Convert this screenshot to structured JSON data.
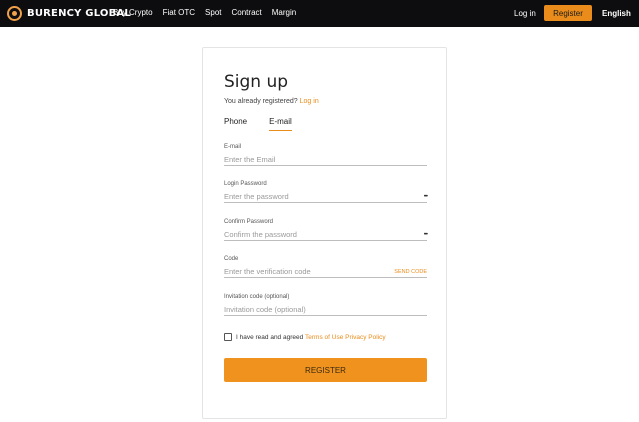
{
  "header": {
    "logo_text": "BURENCY GLOBAL",
    "nav": [
      "Buy Crypto",
      "Fiat OTC",
      "Spot",
      "Contract",
      "Margin"
    ],
    "login_label": "Log in",
    "register_label": "Register",
    "language": "English"
  },
  "form": {
    "title": "Sign up",
    "subtitle_text": "You already registered?",
    "subtitle_link": "Log in",
    "tabs": [
      "Phone",
      "E-mail"
    ],
    "fields": [
      {
        "label": "E-mail",
        "placeholder": "Enter the Email"
      },
      {
        "label": "Login Password",
        "placeholder": "Enter the password"
      },
      {
        "label": "Confirm Password",
        "placeholder": "Confirm the password"
      },
      {
        "label": "Code",
        "placeholder": "Enter the verification code",
        "action": "SEND CODE"
      },
      {
        "label": "Invitation code (optional)",
        "placeholder": "Invitation code (optional)"
      }
    ],
    "agree_text": "I have read and agreed",
    "terms_link": "Terms of Use",
    "privacy_link": "Privacy Policy",
    "submit_label": "REGISTER"
  },
  "colors": {
    "accent": "#e98c1b",
    "topbar": "#0d0d0f"
  }
}
